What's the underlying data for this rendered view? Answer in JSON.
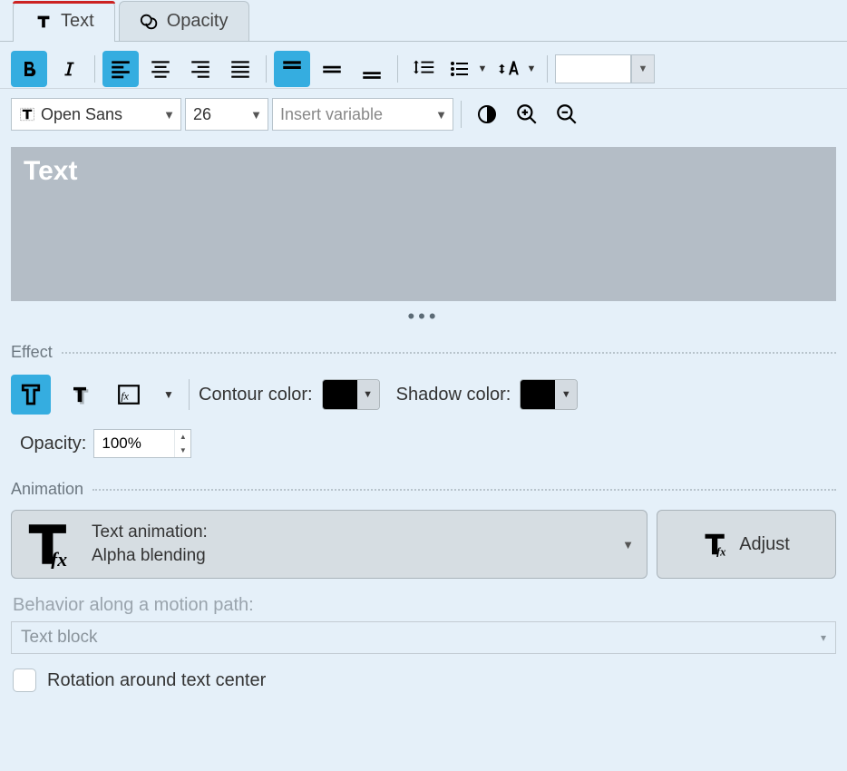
{
  "tabs": {
    "text": "Text",
    "opacity": "Opacity"
  },
  "toolbar": {
    "font": "Open Sans",
    "size": "26",
    "insert_variable": "Insert variable"
  },
  "preview_text": "Text",
  "effect": {
    "header": "Effect",
    "contour_label": "Contour color:",
    "shadow_label": "Shadow color:",
    "contour_color": "#000000",
    "shadow_color": "#000000",
    "opacity_label": "Opacity:",
    "opacity_value": "100%"
  },
  "animation": {
    "header": "Animation",
    "label": "Text animation:",
    "value": "Alpha blending",
    "adjust": "Adjust"
  },
  "behavior": {
    "label": "Behavior along a motion path:",
    "value": "Text block",
    "rotation": "Rotation around text center"
  }
}
